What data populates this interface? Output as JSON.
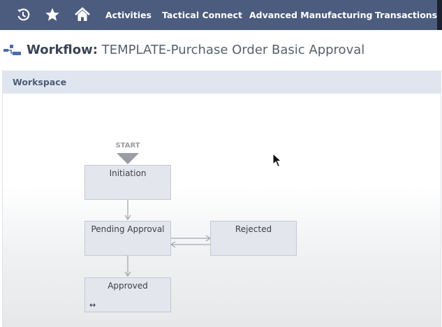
{
  "nav": {
    "icons": [
      "recent-icon",
      "star-icon",
      "home-icon"
    ],
    "items": [
      "Activities",
      "Tactical Connect",
      "Advanced Manufacturing",
      "Transactions"
    ]
  },
  "page": {
    "title_prefix": "Workflow:",
    "title": "TEMPLATE-Purchase Order Basic Approval"
  },
  "workspace": {
    "header": "Workspace",
    "start_label": "START",
    "states": {
      "initiation": "Initiation",
      "pending": "Pending Approval",
      "rejected": "Rejected",
      "approved": "Approved"
    },
    "approved_icon": "loop-icon"
  },
  "colors": {
    "nav_bg": "#4b5c7e",
    "workspace_header_bg": "#e0e6f0",
    "state_bg": "#e4e6ee"
  }
}
